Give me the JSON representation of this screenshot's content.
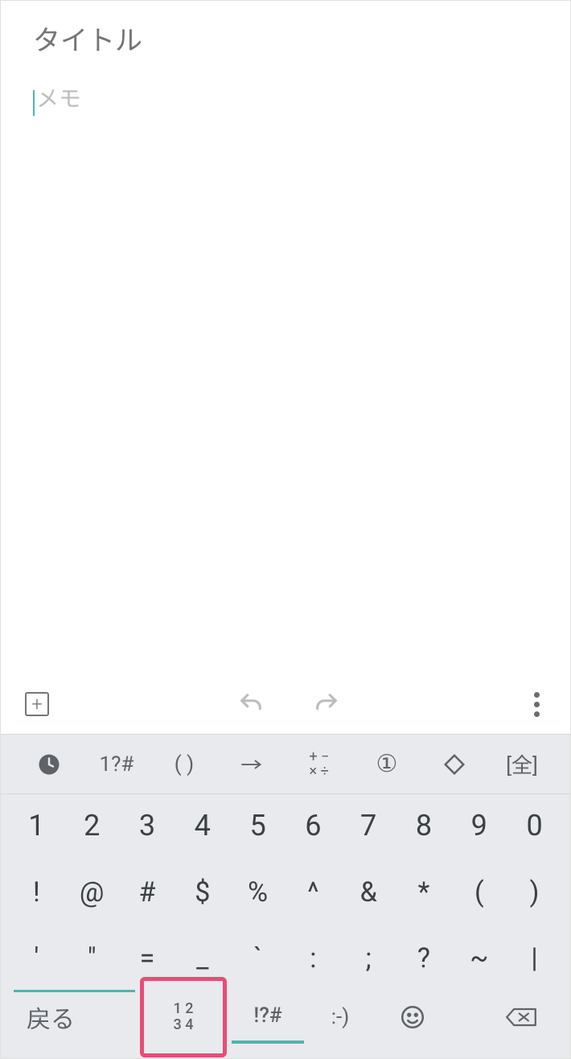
{
  "note": {
    "title_placeholder": "タイトル",
    "memo_placeholder": "メモ"
  },
  "suggestions": {
    "s1": "1?#",
    "s2": "( )",
    "s6": "[全]"
  },
  "keyboard": {
    "row1": [
      "1",
      "2",
      "3",
      "4",
      "5",
      "6",
      "7",
      "8",
      "9",
      "0"
    ],
    "row2": [
      "!",
      "@",
      "#",
      "$",
      "%",
      "^",
      "&",
      "*",
      "(",
      ")"
    ],
    "row3": [
      "'",
      "\"",
      "=",
      "_",
      "`",
      ":",
      ";",
      "?",
      "~",
      "|"
    ]
  },
  "bottom": {
    "back": "戻る",
    "numbers_l1": "1 2",
    "numbers_l2": "3 4",
    "special": "!?#",
    "smiley": ":-)"
  }
}
